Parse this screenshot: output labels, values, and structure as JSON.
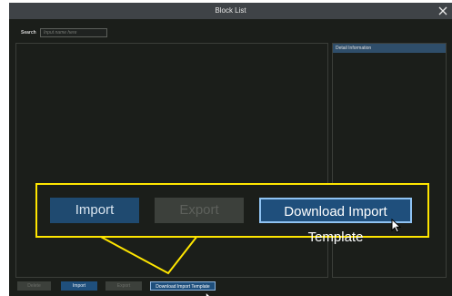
{
  "window": {
    "title": "Block List"
  },
  "search": {
    "label": "Search",
    "placeholder": "Input name here"
  },
  "detail": {
    "header": "Detail Information"
  },
  "toolbar": {
    "delete_label": "Delete",
    "import_label": "Import",
    "export_label": "Export",
    "download_label": "Download Import Template"
  },
  "zoom": {
    "import_label": "Import",
    "export_label": "Export",
    "download_label": "Download Import Template"
  },
  "colors": {
    "accent_yellow": "#ffe600",
    "button_blue": "#1f4f7c",
    "panel_header_blue": "#2f4e6a",
    "background": "#1b1e1a"
  },
  "icons": [
    "close-icon",
    "mouse-cursor-icon"
  ]
}
